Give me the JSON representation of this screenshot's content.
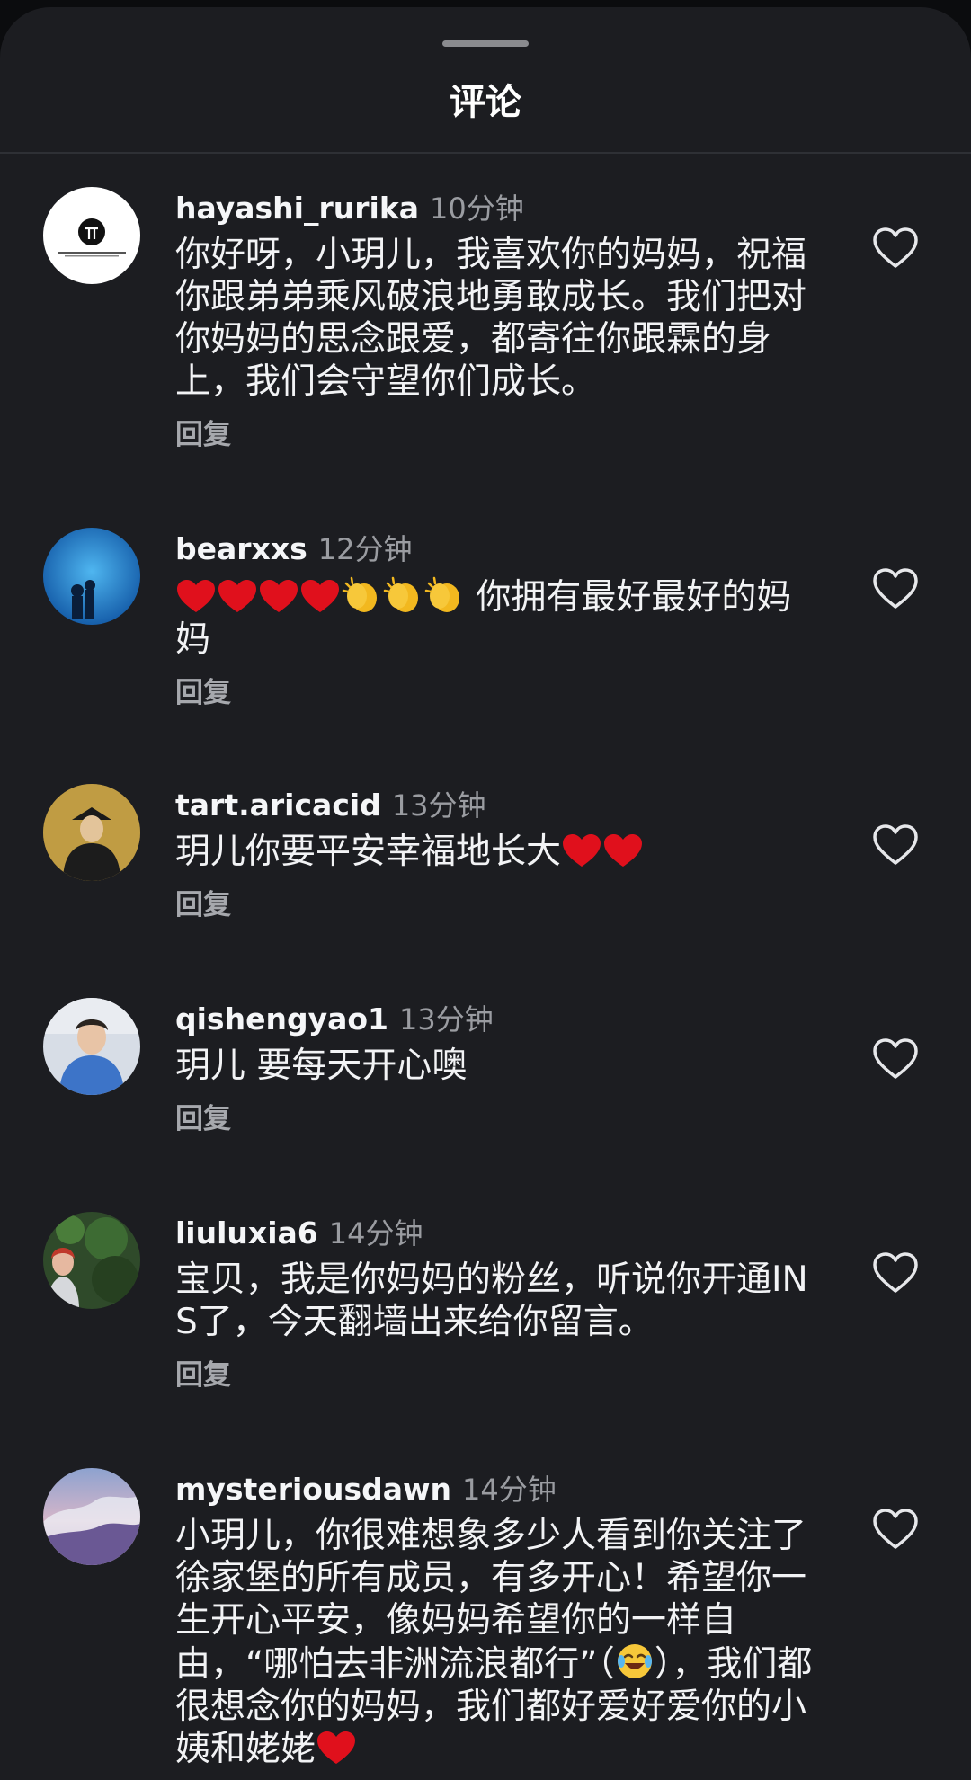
{
  "sheet": {
    "title": "评论"
  },
  "comments": [
    {
      "username": "hayashi_rurika",
      "time": "10分钟",
      "text": "你好呀，小玥儿，我喜欢你的妈妈，祝福你跟弟弟乘风破浪地勇敢成长。我们把对你妈妈的思念跟爱，都寄往你跟霖的身上，我们会守望你们成长。",
      "reply_label": "回复"
    },
    {
      "username": "bearxxs",
      "time": "12分钟",
      "text": "你拥有最好最好的妈妈",
      "leading_emoji": [
        "red-heart",
        "red-heart",
        "red-heart",
        "red-heart",
        "clapping-hands",
        "clapping-hands",
        "clapping-hands"
      ],
      "reply_label": "回复"
    },
    {
      "username": "tart.aricacid",
      "time": "13分钟",
      "text": "玥儿你要平安幸福地长大",
      "trailing_emoji": [
        "red-heart",
        "red-heart"
      ],
      "reply_label": "回复"
    },
    {
      "username": "qishengyao1",
      "time": "13分钟",
      "text": "玥儿 要每天开心噢",
      "reply_label": "回复"
    },
    {
      "username": "liuluxia6",
      "time": "14分钟",
      "text": "宝贝，我是你妈妈的粉丝，听说你开通INS了，今天翻墙出来给你留言。",
      "reply_label": "回复"
    },
    {
      "username": "mysteriousdawn",
      "time": "14分钟",
      "text_part1": "小玥儿，你很难想象多少人看到你关注了徐家堡的所有成员，有多开心！希望你一生开心平安，像妈妈希望你的一样自由，“哪怕去非洲流浪都行”（",
      "text_part2": "），我们都很想念你的妈妈，我们都好爱好爱你的小姨和姥姥",
      "inline_emoji": "face-with-tears-of-joy",
      "trailing_emoji": [
        "red-heart"
      ]
    }
  ],
  "colors": {
    "background": "#1c1d21",
    "text": "#f2f3f5",
    "muted": "#9a9ca1",
    "heart": "#e0101c"
  },
  "icons": {
    "like": "heart-outline-icon"
  }
}
